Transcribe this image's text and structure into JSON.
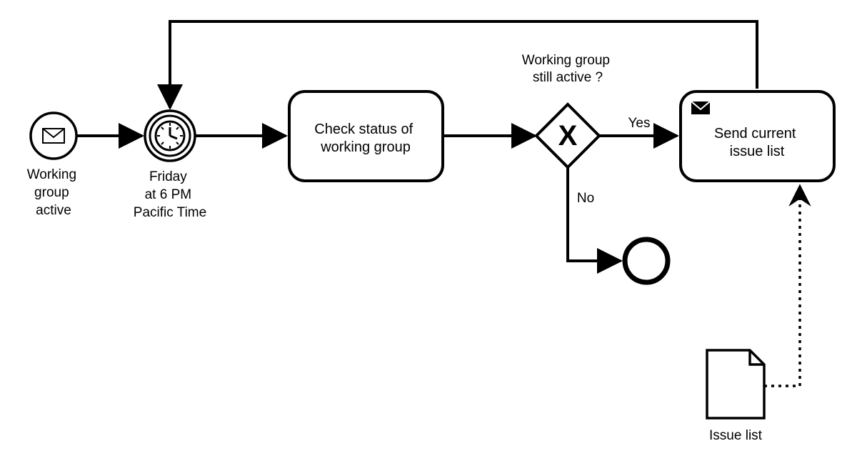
{
  "startEvent": {
    "label_line1": "Working",
    "label_line2": "group",
    "label_line3": "active"
  },
  "timerEvent": {
    "label_line1": "Friday",
    "label_line2": "at 6 PM",
    "label_line3": "Pacific Time"
  },
  "task1": {
    "label_line1": "Check status of",
    "label_line2": "working group"
  },
  "gateway": {
    "caption_line1": "Working group",
    "caption_line2": "still active ?",
    "yes": "Yes",
    "no": "No"
  },
  "task2": {
    "label_line1": "Send current",
    "label_line2": "issue list"
  },
  "dataObject": {
    "label": "Issue list"
  }
}
